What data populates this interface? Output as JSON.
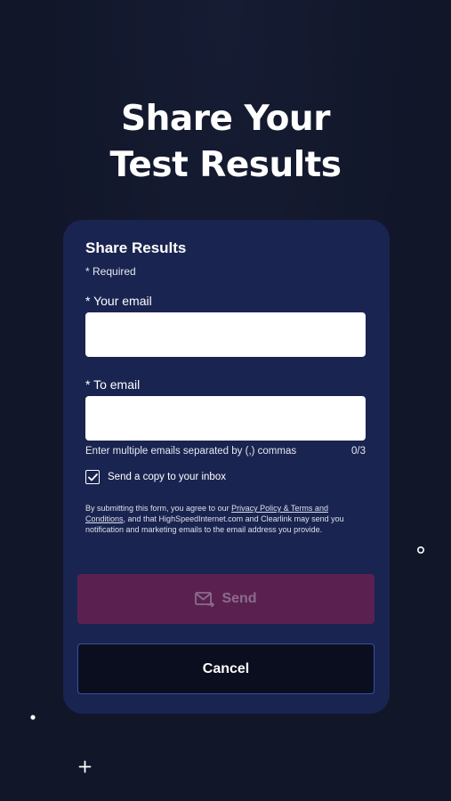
{
  "hero": {
    "title_line1": "Share Your",
    "title_line2": "Test Results"
  },
  "form": {
    "title": "Share Results",
    "required_note": "* Required",
    "your_email": {
      "label": "* Your email",
      "value": "",
      "placeholder": ""
    },
    "to_email": {
      "label": "* To email",
      "value": "",
      "placeholder": ""
    },
    "helper_text": "Enter multiple emails separated by (,) commas",
    "email_count": "0/3",
    "copy_checkbox": {
      "label": "Send a copy to your inbox",
      "checked": true
    },
    "consent": {
      "prefix": "By submitting this form, you agree to our ",
      "link_text": "Privacy Policy & Terms and Conditions",
      "suffix": ", and that HighSpeedInternet.com and Clearlink may send you notification and marketing emails to the email address you provide."
    },
    "send_label": "Send",
    "send_icon": "mail-send-icon",
    "cancel_label": "Cancel"
  },
  "colors": {
    "background": "#111629",
    "card": "#1a2450",
    "send_disabled": "#5a2150",
    "cancel_border": "#3550a8"
  }
}
